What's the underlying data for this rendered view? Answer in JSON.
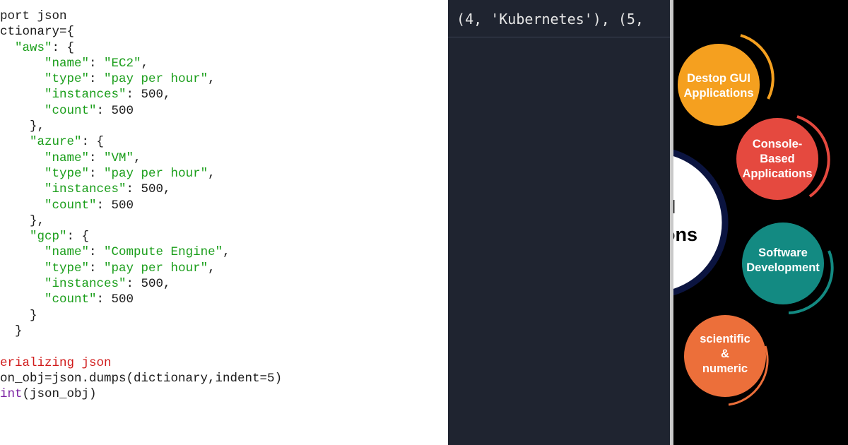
{
  "code_editor": {
    "lines": [
      [
        {
          "t": "port json",
          "c": "plain"
        }
      ],
      [
        {
          "t": "ctionary={",
          "c": "plain"
        }
      ],
      [
        {
          "t": "  ",
          "c": "plain"
        },
        {
          "t": "\"aws\"",
          "c": "str"
        },
        {
          "t": ": {",
          "c": "plain"
        }
      ],
      [
        {
          "t": "      ",
          "c": "plain"
        },
        {
          "t": "\"name\"",
          "c": "str"
        },
        {
          "t": ": ",
          "c": "plain"
        },
        {
          "t": "\"EC2\"",
          "c": "str"
        },
        {
          "t": ",",
          "c": "plain"
        }
      ],
      [
        {
          "t": "      ",
          "c": "plain"
        },
        {
          "t": "\"type\"",
          "c": "str"
        },
        {
          "t": ": ",
          "c": "plain"
        },
        {
          "t": "\"pay per hour\"",
          "c": "str"
        },
        {
          "t": ",",
          "c": "plain"
        }
      ],
      [
        {
          "t": "      ",
          "c": "plain"
        },
        {
          "t": "\"instances\"",
          "c": "str"
        },
        {
          "t": ": 500,",
          "c": "plain"
        }
      ],
      [
        {
          "t": "      ",
          "c": "plain"
        },
        {
          "t": "\"count\"",
          "c": "str"
        },
        {
          "t": ": 500",
          "c": "plain"
        }
      ],
      [
        {
          "t": "    },",
          "c": "plain"
        }
      ],
      [
        {
          "t": "    ",
          "c": "plain"
        },
        {
          "t": "\"azure\"",
          "c": "str"
        },
        {
          "t": ": {",
          "c": "plain"
        }
      ],
      [
        {
          "t": "      ",
          "c": "plain"
        },
        {
          "t": "\"name\"",
          "c": "str"
        },
        {
          "t": ": ",
          "c": "plain"
        },
        {
          "t": "\"VM\"",
          "c": "str"
        },
        {
          "t": ",",
          "c": "plain"
        }
      ],
      [
        {
          "t": "      ",
          "c": "plain"
        },
        {
          "t": "\"type\"",
          "c": "str"
        },
        {
          "t": ": ",
          "c": "plain"
        },
        {
          "t": "\"pay per hour\"",
          "c": "str"
        },
        {
          "t": ",",
          "c": "plain"
        }
      ],
      [
        {
          "t": "      ",
          "c": "plain"
        },
        {
          "t": "\"instances\"",
          "c": "str"
        },
        {
          "t": ": 500,",
          "c": "plain"
        }
      ],
      [
        {
          "t": "      ",
          "c": "plain"
        },
        {
          "t": "\"count\"",
          "c": "str"
        },
        {
          "t": ": 500",
          "c": "plain"
        }
      ],
      [
        {
          "t": "    },",
          "c": "plain"
        }
      ],
      [
        {
          "t": "    ",
          "c": "plain"
        },
        {
          "t": "\"gcp\"",
          "c": "str"
        },
        {
          "t": ": {",
          "c": "plain"
        }
      ],
      [
        {
          "t": "      ",
          "c": "plain"
        },
        {
          "t": "\"name\"",
          "c": "str"
        },
        {
          "t": ": ",
          "c": "plain"
        },
        {
          "t": "\"Compute Engine\"",
          "c": "str"
        },
        {
          "t": ",",
          "c": "plain"
        }
      ],
      [
        {
          "t": "      ",
          "c": "plain"
        },
        {
          "t": "\"type\"",
          "c": "str"
        },
        {
          "t": ": ",
          "c": "plain"
        },
        {
          "t": "\"pay per hour\"",
          "c": "str"
        },
        {
          "t": ",",
          "c": "plain"
        }
      ],
      [
        {
          "t": "      ",
          "c": "plain"
        },
        {
          "t": "\"instances\"",
          "c": "str"
        },
        {
          "t": ": 500,",
          "c": "plain"
        }
      ],
      [
        {
          "t": "      ",
          "c": "plain"
        },
        {
          "t": "\"count\"",
          "c": "str"
        },
        {
          "t": ": 500",
          "c": "plain"
        }
      ],
      [
        {
          "t": "    }",
          "c": "plain"
        }
      ],
      [
        {
          "t": "  }",
          "c": "plain"
        }
      ],
      [
        {
          "t": "",
          "c": "plain"
        }
      ],
      [
        {
          "t": "erializing json",
          "c": "comment"
        }
      ],
      [
        {
          "t": "on_obj=json.dumps(dictionary,indent=5)",
          "c": "plain"
        }
      ],
      [
        {
          "t": "int",
          "c": "builtin"
        },
        {
          "t": "(json_obj)",
          "c": "plain"
        }
      ]
    ]
  },
  "terminal": {
    "output_text": " (4, 'Kubernetes'), (5,"
  },
  "infographic": {
    "center_text_partial_1": "l",
    "center_text_partial_2": "ons",
    "bubbles": [
      {
        "lines": [
          "Destop GUI",
          "Applications"
        ],
        "color": "#f5a01f"
      },
      {
        "lines": [
          "Console-",
          "Based",
          "Applications"
        ],
        "color": "#e5493f"
      },
      {
        "lines": [
          "Software",
          "Development"
        ],
        "color": "#138a82"
      },
      {
        "lines": [
          "scientific",
          "&",
          "numeric"
        ],
        "color": "#ec6f3a"
      }
    ],
    "colors": {
      "background": "#000000",
      "center_ring": "#0b1440",
      "arc_orange": "#f5a01f",
      "arc_red": "#e5493f",
      "arc_teal": "#138a82"
    }
  }
}
